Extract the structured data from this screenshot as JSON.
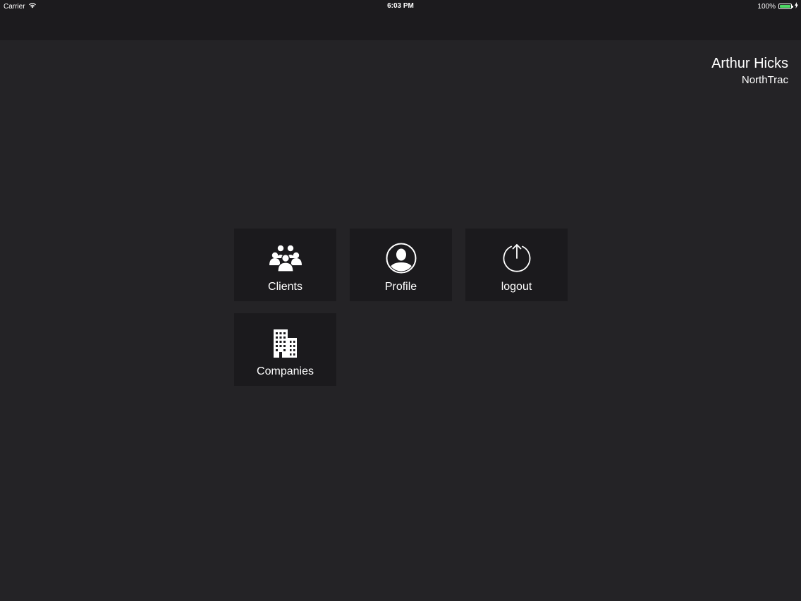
{
  "status_bar": {
    "carrier": "Carrier",
    "time": "6:03 PM",
    "battery": "100%",
    "battery_level": 1.0
  },
  "user": {
    "name": "Arthur Hicks",
    "company": "NorthTrac"
  },
  "tiles": [
    {
      "label": "Clients",
      "icon": "group-icon"
    },
    {
      "label": "Profile",
      "icon": "user-circle-icon"
    },
    {
      "label": "logout",
      "icon": "power-icon"
    },
    {
      "label": "Companies",
      "icon": "buildings-icon"
    }
  ],
  "colors": {
    "background": "#242326",
    "nav_bar": "#1c1b1e",
    "tile": "#1b1a1d",
    "battery": "#4cd964"
  }
}
